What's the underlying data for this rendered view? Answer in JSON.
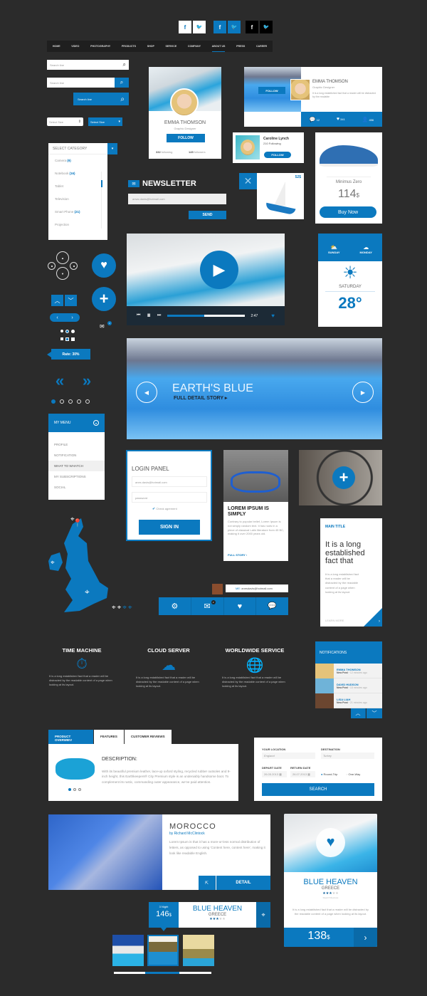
{
  "accent": "#0b79bf",
  "social": {
    "facebook": "f",
    "twitter": "t"
  },
  "nav": {
    "items": [
      "HOME",
      "VIDEO",
      "PHOTOGRAPHY",
      "PRODUCTS",
      "SHOP",
      "SERVICE",
      "COMPANY",
      "ABOUT US",
      "PRESS",
      "CAREER"
    ],
    "active": "ABOUT US"
  },
  "search": {
    "placeholder": "Search line"
  },
  "selects": {
    "white": "Select Size",
    "blue": "Select Size"
  },
  "category": {
    "title": "SELECT CATEGORY",
    "items": [
      {
        "label": "Camera",
        "count": "(9)"
      },
      {
        "label": "Notebook",
        "count": "(16)"
      },
      {
        "label": "Tablet",
        "count": ""
      },
      {
        "label": "Television",
        "count": ""
      },
      {
        "label": "Smart Phone",
        "count": "(21)"
      },
      {
        "label": "Projection",
        "count": ""
      }
    ]
  },
  "profile1": {
    "name": "EMMA THOMSON",
    "role": "Graphic Designer",
    "follow": "FOLLOW",
    "following_num": "332",
    "following_label": "following",
    "followers_num": "145",
    "followers_label": "followers"
  },
  "profile2": {
    "name": "EMMA THOMSON",
    "role": "Graphic Designer",
    "bio": "It is a long established fact that a reader will be distracted by the readable",
    "follow": "FOLLOW",
    "comments": "12",
    "likes": "341",
    "users": "456"
  },
  "caroline": {
    "name": "Caroline Lynch",
    "following": "210 Following",
    "follow": "FOLLOW"
  },
  "shoe": {
    "name": "Minimus Zero",
    "price": "114",
    "currency": "$",
    "buy": "Buy Now"
  },
  "newsletter": {
    "title": "NEWSLETTER",
    "email": "anws.danis@hotmail.com",
    "send": "SEND"
  },
  "boat": {
    "price": "52$"
  },
  "video": {
    "time": "2:47",
    "progress": 0.48
  },
  "weather": {
    "day1": "SUNDAY",
    "day2": "MONDAY",
    "today": "SATURDAY",
    "temp": "28°"
  },
  "controls": {
    "rate": "Rate: 30%",
    "mail_badge": "2"
  },
  "hero": {
    "title": "EARTH'S BLUE",
    "subtitle": "FULL DETAIL STORY ▸"
  },
  "menu": {
    "title": "MY MENU",
    "items": [
      "PROFILE",
      "NOTIFICATION",
      "WHAT TO WHATCH",
      "MY SUBSCRIPTIONS",
      "SOCIAL"
    ],
    "active": "WHAT TO WHATCH"
  },
  "login": {
    "title": "LOGIN PANEL",
    "email": "anes.davis@hotmail.com",
    "password": "password",
    "check": "Check agrement",
    "submit": "SIGN IN"
  },
  "story": {
    "title": "LOREM IPSUM IS SIMPLY",
    "body": "Contrary to popular belief, Lorem Ipsum is not simply random text. It has roots in a piece of classical Latin literature from 45 BC, making it over 2000 years old.",
    "link": "FULL STORY ›"
  },
  "maintitle": {
    "label": "MAIN TITLE",
    "headline": "It is a long established fact that",
    "body": "It is a long established fact that a reader will be distracted by the readable content of a page when looking at its layout.",
    "more": "LEARN MORE"
  },
  "chat": {
    "prefix": "ME:",
    "email": "anesdavis@hotmail.com",
    "badge": "2"
  },
  "features": [
    {
      "title": "TIME MACHINE",
      "icon": "stopwatch-icon",
      "text": "It is a long established fact that a reader will be distracted by the readable content of a page when looking at its layout."
    },
    {
      "title": "CLOUD SERVER",
      "icon": "cloud-icon",
      "text": "It is a long established fact that a reader will be distracted by the readable content of a page when looking at its layout."
    },
    {
      "title": "WORLDWIDE SERVICE",
      "icon": "globe-icon",
      "text": "It is a long established fact that a reader will be distracted by the readable content of a page when looking at its layout."
    }
  ],
  "notifications": {
    "title": "NOTIFICATIONS",
    "items": [
      {
        "name": "EMMA THOMSON",
        "type": "New Post",
        "time": "12 minutes ago"
      },
      {
        "name": "DAVID HUDSON",
        "type": "New Post",
        "time": "18 minutes ago"
      },
      {
        "name": "LISA LIAH",
        "type": "New Post",
        "time": "21 minutes ago"
      }
    ]
  },
  "product": {
    "tabs": [
      "PRODUCT OVERWIEV",
      "FEATURES",
      "CUSTOMER REVIEWS"
    ],
    "heading": "DESCRIPTION:",
    "body": "With its beautiful premium leather, lace-up oxford styling, recycled rubber outsoles and 9-inch height, this Earthkeepers® City Premium style is an undeniably handsome boot. To complement its rustic, commanding outer appearance, we've paid attention."
  },
  "flight": {
    "location_label": "YOUR LOCATION",
    "location": "England",
    "dest_label": "DESTINATION",
    "dest": "Turkey",
    "depart_label": "DEPART DATE",
    "depart": "26.05.2013",
    "return_label": "RETURN DATE",
    "return": "26.07.2013",
    "round": "Round-Trip",
    "oneway": "One-Way",
    "search": "SEARCH"
  },
  "morocco": {
    "title": "MOROCCO",
    "author": "by Richard McClintock",
    "body": "Lorem Ipsum is that it has a more-or-less normal distribution of letters, as opposed to using 'Content here, content here', making it look like readable English.",
    "detail": "DETAIL"
  },
  "heaven_big": {
    "title": "BLUE HEAVEN",
    "country": "GREECE",
    "rating": 3,
    "reviews": "Read 8 Reviews",
    "body": "It is a long established fact that a reader will be distracted by the readable content of a page when looking at its layout.",
    "price": "138",
    "currency": "$"
  },
  "heaven_small": {
    "nights": "3 Night",
    "price": "146",
    "currency": "$",
    "title": "BLUE HEAVEN",
    "country": "GREECE",
    "rating": 3
  }
}
